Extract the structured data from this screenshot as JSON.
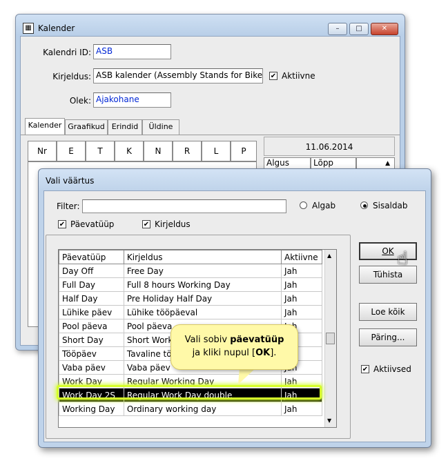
{
  "kalender_window": {
    "title": "Kalender",
    "title_icon": "calendar-icon",
    "controls": {
      "minimize": "–",
      "maximize": "□",
      "close": "✕"
    },
    "fields": {
      "id_label": "Kalendri ID:",
      "id_value": "ASB",
      "desc_label": "Kirjeldus:",
      "desc_value": "ASB kalender (Assembly Stands for Bikes)",
      "active_label": "Aktiivne",
      "active_checked": true,
      "state_label": "Olek:",
      "state_value": "Ajakohane"
    },
    "tabs": [
      "Kalender",
      "Graafikud",
      "Erindid",
      "Üldine"
    ],
    "grid_columns": [
      "Nr",
      "E",
      "T",
      "K",
      "N",
      "R",
      "L",
      "P"
    ],
    "date": "11.06.2014",
    "time_columns": [
      "Algus",
      "Lõpp"
    ]
  },
  "dialog": {
    "title": "Vali väärtus",
    "filter_label": "Filter:",
    "filter_value": "",
    "radio_starts": "Algab",
    "radio_contains": "Sisaldab",
    "selected_mode": "Sisaldab",
    "check_type": "Päevatüüp",
    "check_desc": "Kirjeldus",
    "columns": [
      "Päevatüüp",
      "Kirjeldus",
      "Aktiivne"
    ],
    "rows": [
      [
        "Day Off",
        "Free Day",
        "Jah"
      ],
      [
        "Full Day",
        "Full 8 hours Working Day",
        "Jah"
      ],
      [
        "Half Day",
        "Pre Holiday Half Day",
        "Jah"
      ],
      [
        "Lühike päev",
        "Lühike tööpäeval",
        "Jah"
      ],
      [
        "Pool päeva",
        "Pool päeva",
        "Jah"
      ],
      [
        "Short Day",
        "Short Working Day",
        "Jah"
      ],
      [
        "Tööpäev",
        "Tavaline tööpäev",
        "Jah"
      ],
      [
        "Vaba päev",
        "Vaba päev",
        "Jah"
      ],
      [
        "Work Day",
        "Regular Working Day",
        "Jah"
      ],
      [
        "Work Day 2S",
        "Regular Work Day double",
        "Jah"
      ],
      [
        "Working Day",
        "Ordinary working day",
        "Jah"
      ]
    ],
    "selected_row": 9,
    "buttons": {
      "ok": "OK",
      "cancel": "Tühista",
      "load_all": "Loe kõik",
      "query": "Päring..."
    },
    "active_only_label": "Aktiivsed",
    "active_only_checked": true
  },
  "callout": {
    "line1_pre": "Vali sobiv ",
    "line1_bold": "päevatüüp",
    "line2_pre": "ja kliki nupul [",
    "line2_bold": "OK",
    "line2_post": "]."
  }
}
